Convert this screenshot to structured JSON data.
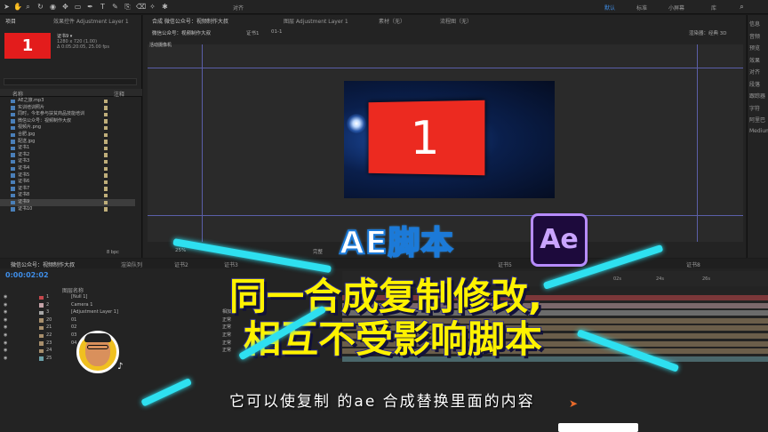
{
  "toolbar": {
    "workspaces": [
      "默认",
      "标准",
      "小屏幕",
      "库"
    ],
    "snap_label": "对齐"
  },
  "project_panel": {
    "tab_project": "项目",
    "tab_effects": "效果控件 Adjustment Layer 1",
    "thumb_number": "1",
    "comp_name": "证书9 ▾",
    "comp_meta_1": "1280 x 720 (1.00)",
    "comp_meta_2": "Δ 0:05:20:05, 25.00 fps",
    "col_name": "名称",
    "col_label": "注释",
    "items": [
      "AE之旅.mp3",
      "实训培训照片",
      "同时，今年参与扶贫商品技能培训",
      "微信公众号：视频制作大叔",
      "视频片.png",
      "合肥.jpg",
      "配送.jpg",
      "证书1",
      "证书2",
      "证书3",
      "证书4",
      "证书5",
      "证书6",
      "证书7",
      "证书8",
      "证书9",
      "证书10"
    ],
    "bpc": "8 bpc"
  },
  "comp_panel": {
    "tab_comp": "合成 微信公众号：视频制作大叔",
    "tab_layer": "图层 Adjustment Layer 1",
    "tab_footage": "素材（无）",
    "tab_flow": "流程图（无）",
    "breadcrumb_1": "微信公众号：视频制作大叔",
    "breadcrumb_2": "证书1",
    "breadcrumb_3": "01-1",
    "renderer": "渲染器：经典 3D",
    "active_camera": "活动摄像机",
    "card_number": "1",
    "zoom": "25%",
    "view_quality": "完整"
  },
  "right_panel": {
    "labels": [
      "信息",
      "音频",
      "预览",
      "效果",
      "对齐",
      "段落",
      "跟踪器",
      "字符",
      "阿里巴",
      "Medium"
    ]
  },
  "timeline": {
    "tabs": [
      "微信公众号：视频制作大叔",
      "渲染队列",
      "证书2",
      "证书3",
      "证书5",
      "证书8"
    ],
    "timecode": "0:00:02:02",
    "col_layer_name": "图层名称",
    "ruler_ticks": [
      "02s",
      "24s",
      "26s"
    ],
    "layers": [
      {
        "num": "1",
        "name": "[Null 1]",
        "mode": "",
        "color": "#c5484d"
      },
      {
        "num": "2",
        "name": "Camera 1",
        "mode": "",
        "color": "#c5a3a8"
      },
      {
        "num": "3",
        "name": "[Adjustment Layer 1]",
        "mode": "相加",
        "color": "#a8a8a8"
      },
      {
        "num": "20",
        "name": "01",
        "mode": "正常",
        "color": "#a88f6c"
      },
      {
        "num": "21",
        "name": "02",
        "mode": "正常",
        "color": "#a88f6c"
      },
      {
        "num": "22",
        "name": "03",
        "mode": "正常",
        "color": "#a88f6c"
      },
      {
        "num": "23",
        "name": "04",
        "mode": "正常",
        "color": "#a88f6c"
      },
      {
        "num": "24",
        "name": "",
        "mode": "正常",
        "color": "#a88f6c"
      },
      {
        "num": "25",
        "name": "",
        "mode": "",
        "color": "#6ba0a8"
      }
    ],
    "parent_null": "1. Null 1",
    "parent_none": "无"
  },
  "overlay": {
    "ae_title": "AE脚本",
    "ae_logo": "Ae",
    "headline_1": "同一合成复制修改,",
    "headline_2": "相互不受影响脚本",
    "subtitle": "它可以使复制 的ae 合成替换里面的内容",
    "accent_color": "#2ee0f0",
    "headline_color": "#fff200"
  }
}
